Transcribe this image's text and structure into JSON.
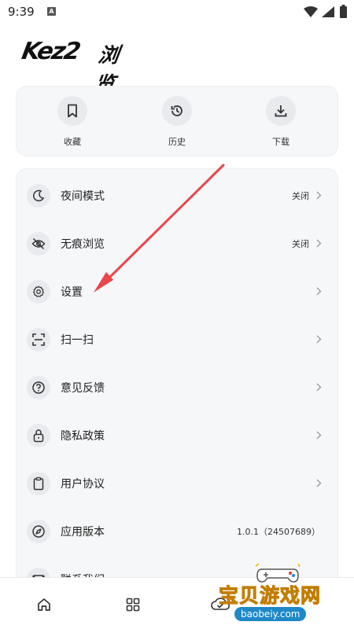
{
  "status_bar": {
    "time": "9:39",
    "notif_icon": "a-icon"
  },
  "app": {
    "logo_latin": "Kez2",
    "logo_cjk": "浏览器"
  },
  "quick_actions": [
    {
      "label": "收藏",
      "icon": "bookmark-icon"
    },
    {
      "label": "历史",
      "icon": "history-icon"
    },
    {
      "label": "下载",
      "icon": "download-icon"
    }
  ],
  "menu": [
    {
      "label": "夜间模式",
      "value": "关闭",
      "icon": "moon-icon"
    },
    {
      "label": "无痕浏览",
      "value": "关闭",
      "icon": "eye-off-icon"
    },
    {
      "label": "设置",
      "value": "",
      "icon": "gear-icon"
    },
    {
      "label": "扫一扫",
      "value": "",
      "icon": "scan-icon"
    },
    {
      "label": "意见反馈",
      "value": "",
      "icon": "help-icon"
    },
    {
      "label": "隐私政策",
      "value": "",
      "icon": "lock-icon"
    },
    {
      "label": "用户协议",
      "value": "",
      "icon": "clipboard-icon"
    },
    {
      "label": "应用版本",
      "value": "1.0.1（24507689）",
      "icon": "compass-icon"
    },
    {
      "label": "联系我们",
      "value": "",
      "icon": "mail-icon"
    }
  ],
  "bottom_nav": [
    {
      "name": "home",
      "icon": "home-icon"
    },
    {
      "name": "apps",
      "icon": "grid-icon"
    },
    {
      "name": "cloud",
      "icon": "cloud-icon"
    }
  ],
  "annotation": {
    "arrow_color": "#e8474c"
  },
  "watermark": {
    "title": "宝贝游戏网",
    "url": "baobeiy.com"
  },
  "colors": {
    "card_bg": "#f6f7f9",
    "icon_bg": "#e8eaee",
    "text": "#1e1e1e"
  }
}
